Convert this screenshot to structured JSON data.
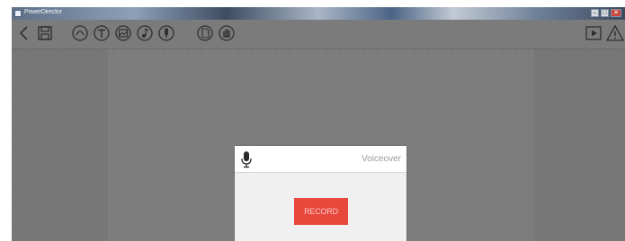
{
  "window": {
    "title": "PowerDirector",
    "controls": {
      "minimize": "–",
      "maximize": "□",
      "close": "✕"
    }
  },
  "toolbar": {
    "left_buttons": [
      {
        "icon": "back-icon"
      },
      {
        "icon": "save-icon"
      }
    ],
    "tool_buttons": [
      {
        "icon": "shape-circle-icon"
      },
      {
        "icon": "text-icon"
      },
      {
        "icon": "image-icon"
      },
      {
        "icon": "music-icon"
      },
      {
        "icon": "microphone-icon"
      },
      {
        "icon": "document-icon"
      },
      {
        "icon": "hand-icon"
      }
    ],
    "right_buttons": [
      {
        "icon": "play-icon"
      },
      {
        "icon": "warning-icon"
      }
    ]
  },
  "dialog": {
    "title": "Voiceover",
    "record_label": "RECORD",
    "accent_color": "#e8473c"
  }
}
